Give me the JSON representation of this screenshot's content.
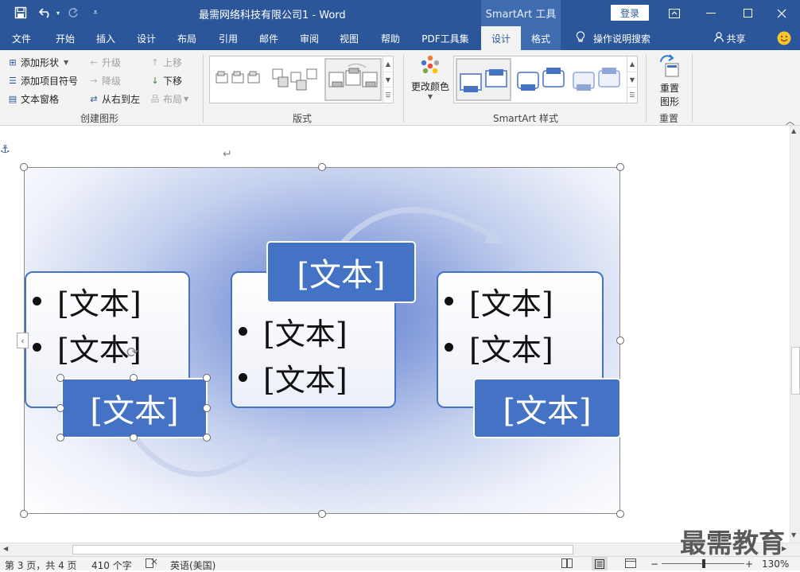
{
  "titlebar": {
    "doc_title": "最需网络科技有限公司1  -  Word",
    "context_tools": "SmartArt 工具",
    "login": "登录"
  },
  "tabs": [
    "文件",
    "开始",
    "插入",
    "设计",
    "布局",
    "引用",
    "邮件",
    "审阅",
    "视图",
    "帮助",
    "PDF工具集",
    "设计",
    "格式"
  ],
  "tell_me": "操作说明搜索",
  "share": "共享",
  "ribbon": {
    "create": {
      "add_shape": "添加形状",
      "add_bullet": "添加项目符号",
      "text_pane": "文本窗格",
      "promote": "升级",
      "demote": "降级",
      "rtl": "从右到左",
      "move_up": "上移",
      "move_down": "下移",
      "layout": "布局",
      "group_label": "创建图形"
    },
    "layouts_label": "版式",
    "change_colors": "更改颜色",
    "styles_label": "SmartArt 样式",
    "reset_line1": "重置",
    "reset_line2": "图形",
    "reset_group_label": "重置"
  },
  "document": {
    "paragraph_mark": "↵",
    "smartart": {
      "placeholder": "[文本]"
    }
  },
  "status": {
    "page": "第 3 页，共 4 页",
    "words": "410 个字",
    "lang": "英语(美国)",
    "zoom": "130%"
  },
  "watermark": "最需教育",
  "colors": {
    "accent": "#2b579a",
    "smartart_blue": "#4472c4"
  }
}
